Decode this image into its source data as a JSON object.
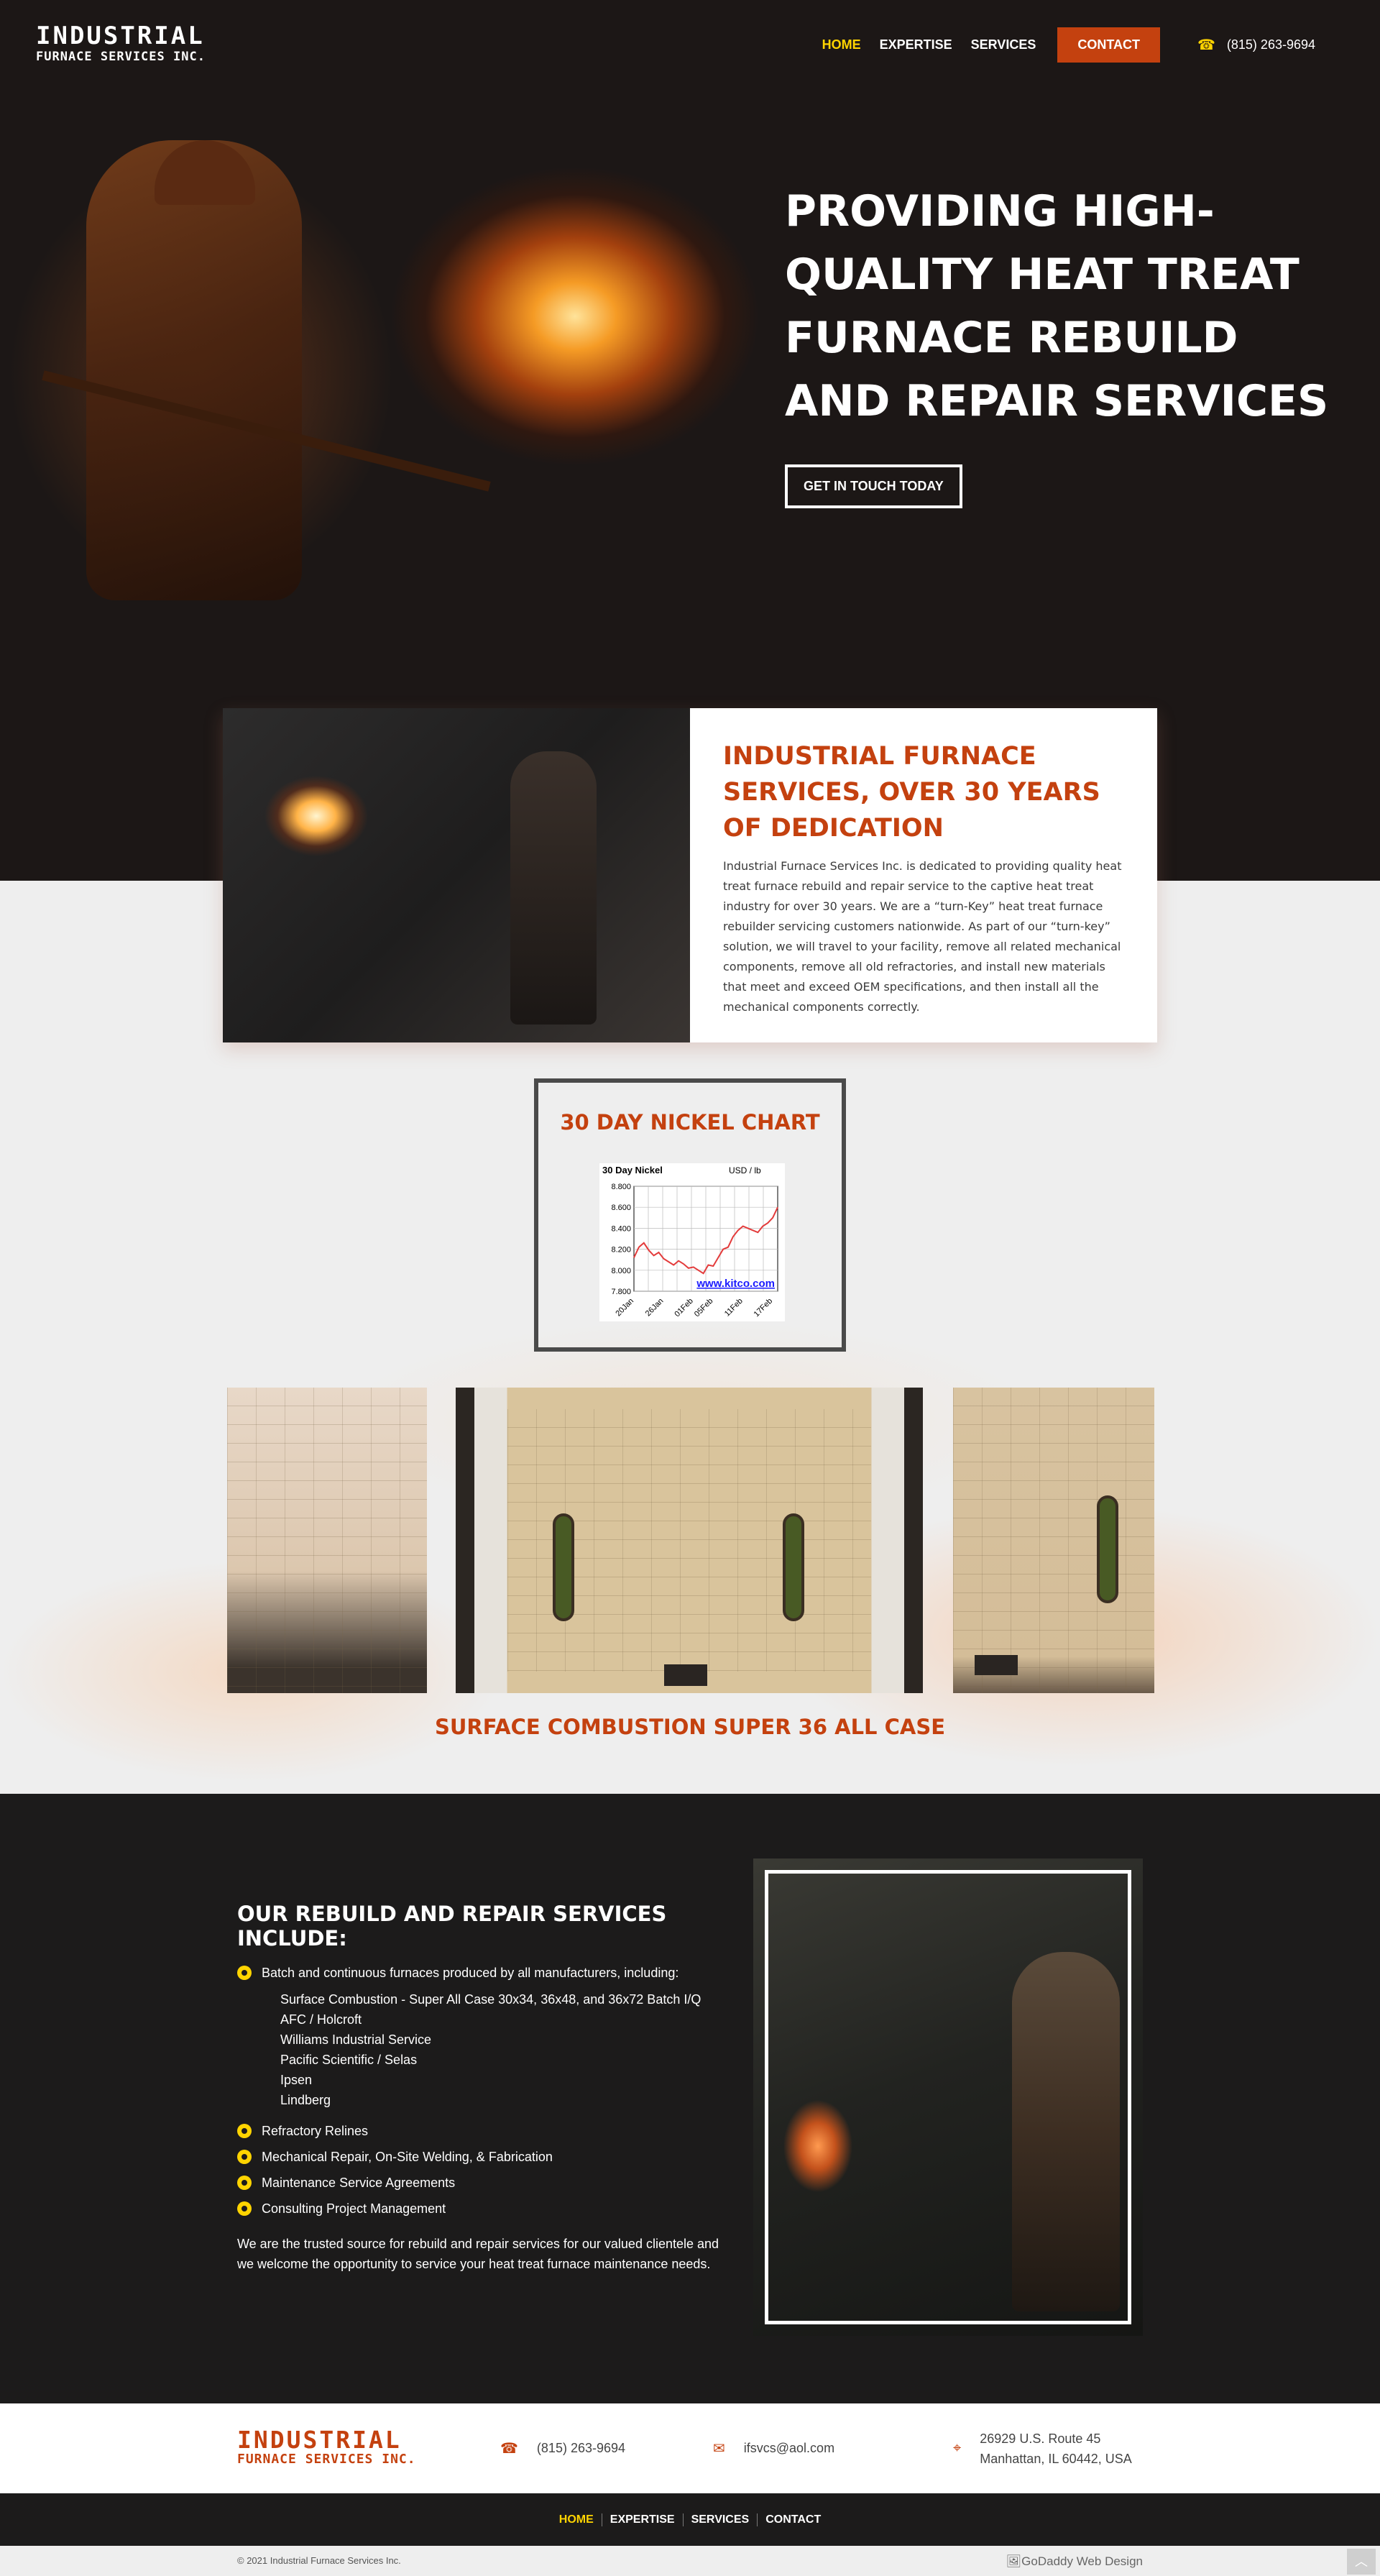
{
  "brand": {
    "line1": "INDUSTRIAL",
    "line2": "FURNACE SERVICES INC."
  },
  "nav": {
    "home": "HOME",
    "expertise": "EXPERTISE",
    "services": "SERVICES",
    "contact": "CONTACT",
    "phone": "(815) 263-9694"
  },
  "hero": {
    "title": "PROVIDING HIGH-QUALITY HEAT TREAT FURNACE REBUILD AND REPAIR SERVICES",
    "cta": "GET IN TOUCH TODAY"
  },
  "about": {
    "title": "INDUSTRIAL FURNACE SERVICES, OVER 30 YEARS OF DEDICATION",
    "body": "Industrial Furnace Services Inc. is dedicated to providing quality heat treat furnace rebuild and repair service to the captive heat treat industry for over 30 years. We are a “turn-Key” heat treat furnace rebuilder servicing customers nationwide. As part of our “turn-key” solution, we will travel to your facility, remove all related mechanical components, remove all old refractories, and install new materials that meet and exceed OEM specifications, and then install all the mechanical components correctly."
  },
  "nickel": {
    "heading": "30 DAY NICKEL CHART"
  },
  "chart_data": {
    "type": "line",
    "title": "30 Day Nickel",
    "unit": "USD / lb",
    "x": [
      "20Jan",
      "21Jan",
      "22Jan",
      "23Jan",
      "24Jan",
      "25Jan",
      "26Jan",
      "27Jan",
      "28Jan",
      "29Jan",
      "30Jan",
      "31Jan",
      "01Feb",
      "02Feb",
      "03Feb",
      "04Feb",
      "05Feb",
      "06Feb",
      "07Feb",
      "08Feb",
      "09Feb",
      "10Feb",
      "11Feb",
      "12Feb",
      "13Feb",
      "14Feb",
      "15Feb",
      "16Feb",
      "17Feb",
      "18Feb"
    ],
    "y": [
      8.12,
      8.22,
      8.26,
      8.19,
      8.14,
      8.17,
      8.11,
      8.08,
      8.05,
      8.09,
      8.06,
      8.02,
      8.03,
      8.0,
      7.97,
      8.05,
      8.04,
      8.12,
      8.2,
      8.22,
      8.32,
      8.38,
      8.42,
      8.4,
      8.38,
      8.36,
      8.42,
      8.45,
      8.5,
      8.6
    ],
    "xticks": [
      "20Jan",
      "26Jan",
      "01Feb",
      "05Feb",
      "11Feb",
      "17Feb"
    ],
    "yticks": [
      "7.800",
      "8.000",
      "8.200",
      "8.400",
      "8.600",
      "8.800"
    ],
    "ylim": [
      7.8,
      8.8
    ],
    "watermark": "www.kitco.com",
    "grid": true,
    "colors": {
      "line": "#e33b3b",
      "watermark": "#1a1aff"
    }
  },
  "gallery": {
    "caption": "SURFACE COMBUSTION SUPER 36 ALL CASE"
  },
  "services": {
    "title": "OUR REBUILD AND REPAIR SERVICES INCLUDE:",
    "item1": "Batch and continuous furnaces produced by all manufacturers, including:",
    "sub": [
      "Surface Combustion - Super All Case 30x34, 36x48, and 36x72 Batch I/Q",
      "AFC / Holcroft",
      "Williams Industrial Service",
      "Pacific Scientific / Selas",
      "Ipsen",
      "Lindberg"
    ],
    "items": [
      "Refractory Relines",
      "Mechanical Repair, On-Site Welding, & Fabrication",
      "Maintenance Service Agreements",
      "Consulting Project Management"
    ],
    "paragraph": "We are the trusted source for rebuild and repair services for our valued clientele and we welcome the opportunity to service your heat treat furnace maintenance needs."
  },
  "contact": {
    "phone": "(815) 263-9694",
    "email": "ifsvcs@aol.com",
    "address1": "26929 U.S. Route 45",
    "address2": "Manhattan, IL 60442, USA"
  },
  "footer": {
    "copyright": "© 2021 Industrial Furnace Services Inc.",
    "godaddy": "GoDaddy Web Design"
  },
  "icons": {
    "phone": "phone-icon",
    "email": "envelope-icon",
    "address": "map-icon",
    "scroll": "chevron-up-icon"
  },
  "colors": {
    "accent": "#c4410f",
    "highlight": "#ffd400",
    "dark": "#1c1b1b"
  }
}
